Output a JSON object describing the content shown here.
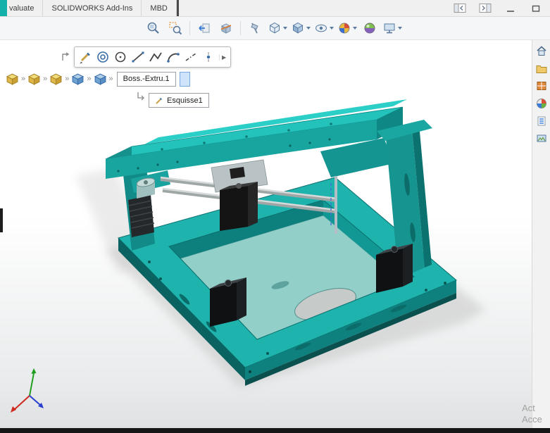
{
  "tabs": {
    "items": [
      "valuate",
      "SOLIDWORKS Add-Ins",
      "MBD"
    ]
  },
  "window_controls": {
    "icons": [
      "collapse-panel-left",
      "collapse-panel-right",
      "minimize",
      "restore"
    ]
  },
  "heads_up_toolbar": {
    "icons": [
      "zoom-to-fit",
      "zoom-to-area",
      "previous-view",
      "section-view",
      "dynamic-annotation-views",
      "view-orientation",
      "display-style",
      "hide-show-items",
      "edit-appearance",
      "apply-scene",
      "view-settings"
    ]
  },
  "context_toolbar": {
    "icons": [
      "sketch",
      "concentric-relation",
      "circle",
      "line",
      "polyline",
      "arc",
      "centerline",
      "point"
    ],
    "flyout_glyph": "▶"
  },
  "breadcrumbs": {
    "chevron_glyph": "»",
    "items": [
      {
        "type": "part"
      },
      {
        "type": "part"
      },
      {
        "type": "part"
      },
      {
        "type": "feature"
      },
      {
        "type": "feature"
      }
    ],
    "feature_label": "Boss.-Extru.1"
  },
  "sketch": {
    "label": "Esquisse1"
  },
  "task_pane": {
    "icons": [
      "home",
      "file-explorer",
      "design-library",
      "appearances",
      "custom-properties",
      "view-palette"
    ]
  },
  "watermark": {
    "line1": "Act",
    "line2": "Acce"
  },
  "model": {
    "description": "teal 3d-printer frame assembly with stepper motors and rods"
  },
  "colors": {
    "teal_bright": "#23c2bb",
    "teal_mid": "#18a5a0",
    "teal_dark": "#0a6361",
    "plate": "#93cfc9",
    "motor_black": "#101214",
    "accent_blue": "#3f72d6",
    "tab_accent": "#14b0aa"
  }
}
